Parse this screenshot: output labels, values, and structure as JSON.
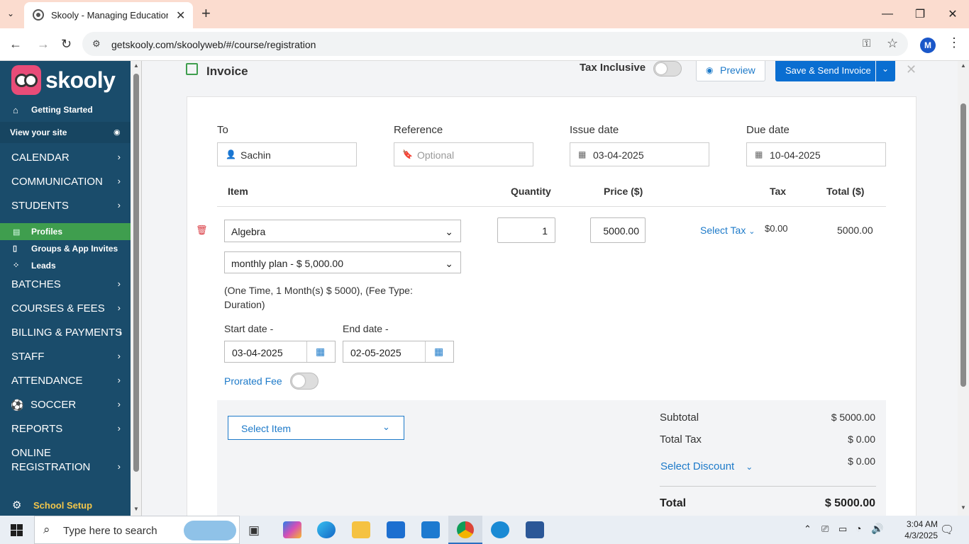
{
  "browser": {
    "tab_title": "Skooly - Managing Educational",
    "url": "getskooly.com/skoolyweb/#/course/registration",
    "avatar_letter": "M"
  },
  "sidebar": {
    "brand": "skooly",
    "getting_started": "Getting Started",
    "view_site": "View your site",
    "items_top": [
      "CALENDAR",
      "COMMUNICATION",
      "STUDENTS"
    ],
    "sub_items": [
      "Profiles",
      "Groups & App Invites",
      "Leads"
    ],
    "items_bottom": [
      "BATCHES",
      "COURSES & FEES",
      "BILLING & PAYMENTS",
      "STAFF",
      "ATTENDANCE",
      "SOCCER",
      "REPORTS"
    ],
    "online_reg_1": "ONLINE",
    "online_reg_2": "REGISTRATION",
    "school_setup": "School Setup"
  },
  "header": {
    "title": "Invoice",
    "tax_inclusive": "Tax Inclusive",
    "preview": "Preview",
    "save_send": "Save & Send Invoice"
  },
  "form": {
    "to_label": "To",
    "to_value": "Sachin",
    "ref_label": "Reference",
    "ref_placeholder": "Optional",
    "issue_label": "Issue date",
    "issue_value": "03-04-2025",
    "due_label": "Due date",
    "due_value": "10-04-2025"
  },
  "table": {
    "headers": {
      "item": "Item",
      "qty": "Quantity",
      "price": "Price ($)",
      "tax": "Tax",
      "total": "Total ($)"
    },
    "row": {
      "item": "Algebra",
      "plan": "monthly plan - $ 5,000.00",
      "desc_1": "(One Time, 1 Month(s) $ 5000), (Fee Type:",
      "desc_2": "Duration)",
      "qty": "1",
      "price": "5000.00",
      "tax_select": "Select Tax",
      "tax_value": "$0.00",
      "total": "5000.00",
      "start_label": "Start date -",
      "start_value": "03-04-2025",
      "end_label": "End date -",
      "end_value": "02-05-2025",
      "prorated": "Prorated Fee"
    }
  },
  "summary": {
    "select_item": "Select Item",
    "subtotal_label": "Subtotal",
    "subtotal": "$ 5000.00",
    "total_tax_label": "Total Tax",
    "total_tax": "$ 0.00",
    "discount_label": "Select Discount",
    "discount": "$ 0.00",
    "total_label": "Total",
    "total": "$ 5000.00"
  },
  "taskbar": {
    "search": "Type here to search",
    "time": "3:04 AM",
    "date": "4/3/2025"
  },
  "colors": {
    "sidebar": "#1a4c6b",
    "accent": "#0a6ed1",
    "active": "#3f9e4e",
    "delete": "#d9363e"
  }
}
